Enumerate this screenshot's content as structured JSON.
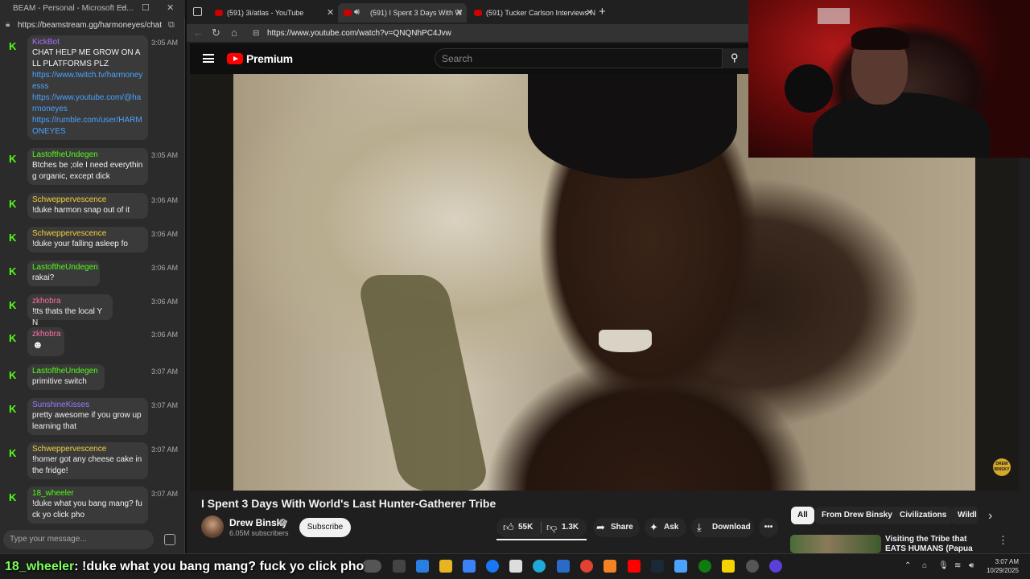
{
  "chat_window": {
    "title": "BEAM - Personal - Microsoft Ed...",
    "url": "https://beamstream.gg/harmoneyes/chat",
    "input_placeholder": "Type your message...",
    "messages": [
      {
        "user": "KickBot",
        "color": "#a970ff",
        "time": "3:05 AM",
        "text": "CHAT HELP ME GROW ON ALL PLATFORMS PLZ",
        "links": [
          "https://www.twitch.tv/harmoneyesss",
          "https://www.youtube.com/@harmoneyes",
          "https://rumble.com/user/HARMONEYES"
        ]
      },
      {
        "user": "LastoftheUndegen",
        "color": "#53fc18",
        "time": "3:05 AM",
        "text": "Btches be ;ole I need everything organic, except dick"
      },
      {
        "user": "Schweppervescence",
        "color": "#f4d03f",
        "time": "3:06 AM",
        "text": "!duke harmon snap out of it"
      },
      {
        "user": "Schweppervescence",
        "color": "#f4d03f",
        "time": "3:06 AM",
        "text": "!duke your falling asleep fo"
      },
      {
        "user": "LastoftheUndegen",
        "color": "#53fc18",
        "time": "3:06 AM",
        "text": "rakai?"
      },
      {
        "user": "zkhobra",
        "color": "#ff6fa8",
        "time": "3:06 AM",
        "text": "!tts thats the local Y N"
      },
      {
        "user": "zkhobra",
        "color": "#ff6fa8",
        "time": "3:06 AM",
        "text": "☻"
      },
      {
        "user": "LastoftheUndegen",
        "color": "#53fc18",
        "time": "3:07 AM",
        "text": "primitive switch"
      },
      {
        "user": "SunshineKisses",
        "color": "#9b7bff",
        "time": "3:07 AM",
        "text": "pretty awesome if you grow up learning that"
      },
      {
        "user": "Schweppervescence",
        "color": "#f4d03f",
        "time": "3:07 AM",
        "text": "!homer got any cheese cake in the fridge!"
      },
      {
        "user": "18_wheeler",
        "color": "#53fc18",
        "time": "3:07 AM",
        "text": "!duke what you bang mang? fuck yo click pho"
      }
    ]
  },
  "browser": {
    "tabs": [
      {
        "label": "(591) 3i/atlas - YouTube",
        "active": false
      },
      {
        "label": "(591) I Spent 3 Days With W",
        "active": true
      },
      {
        "label": "(591) Tucker Carlson Interviews N",
        "active": false
      }
    ],
    "url": "https://www.youtube.com/watch?v=QNQNhPC4Jvw"
  },
  "youtube": {
    "logo_text": "Premium",
    "search_placeholder": "Search",
    "video_title": "I Spent 3 Days With World's Last Hunter-Gatherer Tribe",
    "channel": "Drew Binsky",
    "subscribers": "6.05M subscribers",
    "subscribe_label": "Subscribe",
    "likes": "55K",
    "dislikes": "1.3K",
    "share_label": "Share",
    "ask_label": "Ask",
    "download_label": "Download",
    "watermark": "DREW BINSKY",
    "chips": [
      "All",
      "From Drew Binsky",
      "Civilizations",
      "Wildl"
    ],
    "related_title": "Visiting the Tribe that EATS HUMANS (Papua Island)"
  },
  "overlay": {
    "user": "18_wheeler",
    "message": ": !duke what you bang mang? fuck yo click pho"
  },
  "taskbar": {
    "time": "3:07 AM",
    "date": "10/29/2025"
  },
  "colors": {
    "accent_green": "#53fc18",
    "youtube_red": "#ff0000"
  }
}
